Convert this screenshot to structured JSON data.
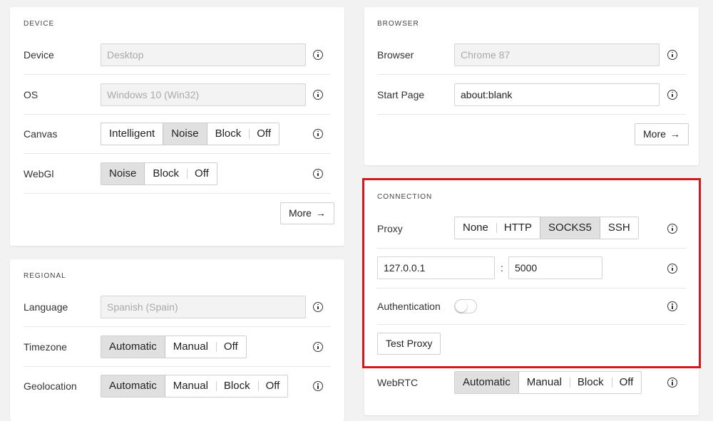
{
  "device": {
    "section_title": "DEVICE",
    "device": {
      "label": "Device",
      "value": "Desktop"
    },
    "os": {
      "label": "OS",
      "value": "Windows 10 (Win32)"
    },
    "canvas": {
      "label": "Canvas",
      "options": [
        "Intelligent",
        "Noise",
        "Block",
        "Off"
      ],
      "selected": "Noise"
    },
    "webgl": {
      "label": "WebGl",
      "options": [
        "Noise",
        "Block",
        "Off"
      ],
      "selected": "Noise"
    },
    "more_label": "More"
  },
  "regional": {
    "section_title": "REGIONAL",
    "language": {
      "label": "Language",
      "value": "Spanish (Spain)"
    },
    "timezone": {
      "label": "Timezone",
      "options": [
        "Automatic",
        "Manual",
        "Off"
      ],
      "selected": "Automatic"
    },
    "geolocation": {
      "label": "Geolocation",
      "options": [
        "Automatic",
        "Manual",
        "Block",
        "Off"
      ],
      "selected": "Automatic"
    }
  },
  "browser": {
    "section_title": "BROWSER",
    "browser": {
      "label": "Browser",
      "value": "Chrome 87"
    },
    "start_page": {
      "label": "Start Page",
      "value": "about:blank"
    },
    "more_label": "More"
  },
  "connection": {
    "section_title": "CONNECTION",
    "proxy": {
      "label": "Proxy",
      "options": [
        "None",
        "HTTP",
        "SOCKS5",
        "SSH"
      ],
      "selected": "SOCKS5"
    },
    "host": "127.0.0.1",
    "separator": ":",
    "port": "5000",
    "authentication": {
      "label": "Authentication",
      "enabled": false
    },
    "test_proxy_label": "Test Proxy",
    "webrtc": {
      "label": "WebRTC",
      "options": [
        "Automatic",
        "Manual",
        "Block",
        "Off"
      ],
      "selected": "Automatic"
    }
  },
  "colors": {
    "highlight": "#d9161c",
    "active_segment": "#e0e0e0"
  }
}
